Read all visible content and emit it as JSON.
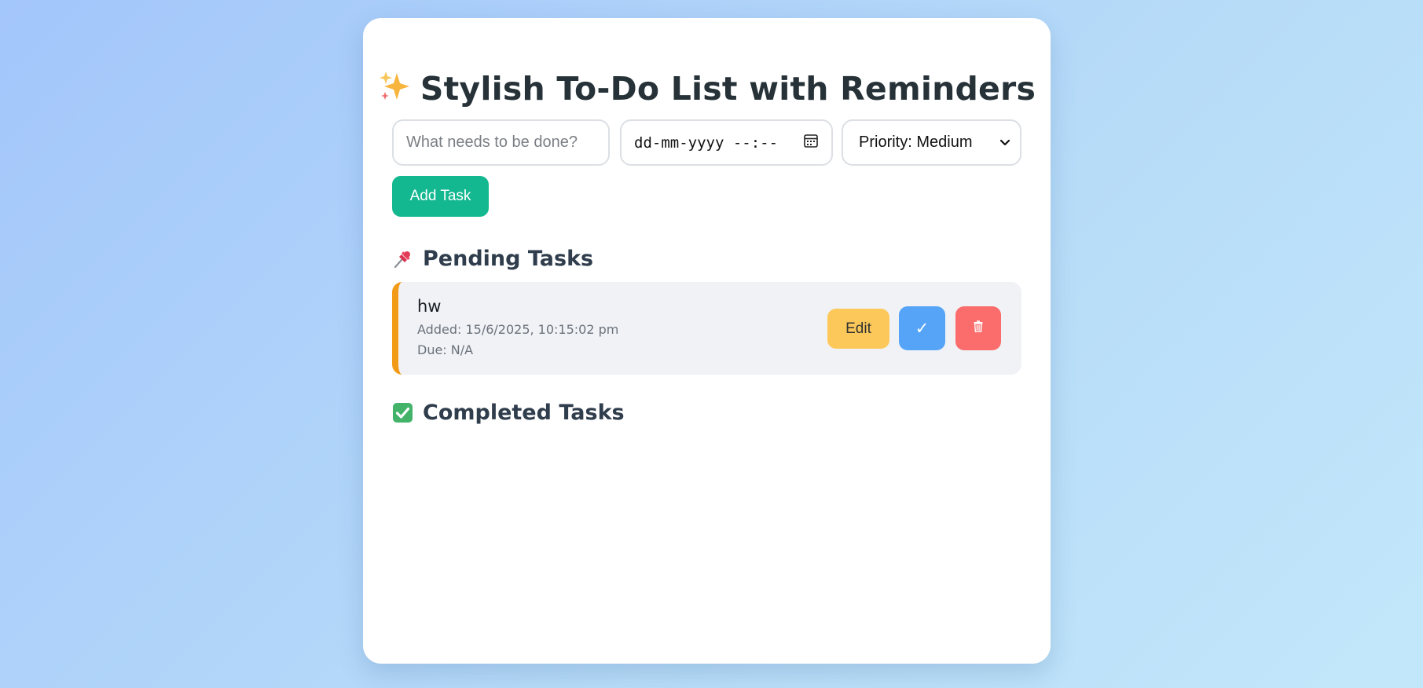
{
  "app": {
    "title": "Stylish To-Do List with Reminders",
    "title_icon": "sparkles-icon"
  },
  "form": {
    "task_placeholder": "What needs to be done?",
    "task_value": "",
    "due_placeholder": "dd-mm-yyyy --:--",
    "due_icon": "calendar-icon",
    "priority_selected": "Priority: Medium",
    "add_button_label": "Add Task"
  },
  "pending": {
    "heading": "Pending Tasks",
    "icon": "pushpin-icon",
    "tasks": [
      {
        "name": "hw",
        "added": "Added: 15/6/2025, 10:15:02 pm",
        "due": "Due: N/A",
        "priority_color": "#f29b18",
        "edit_label": "Edit",
        "complete_label": "✓",
        "delete_icon": "trash-icon"
      }
    ]
  },
  "completed": {
    "heading": "Completed Tasks",
    "icon": "check-box-icon",
    "tasks": []
  },
  "colors": {
    "accent_green": "#14b890",
    "edit_yellow": "#fdc85a",
    "complete_blue": "#56a4f7",
    "delete_red": "#fb6c6c",
    "priority_medium": "#f29b18"
  }
}
